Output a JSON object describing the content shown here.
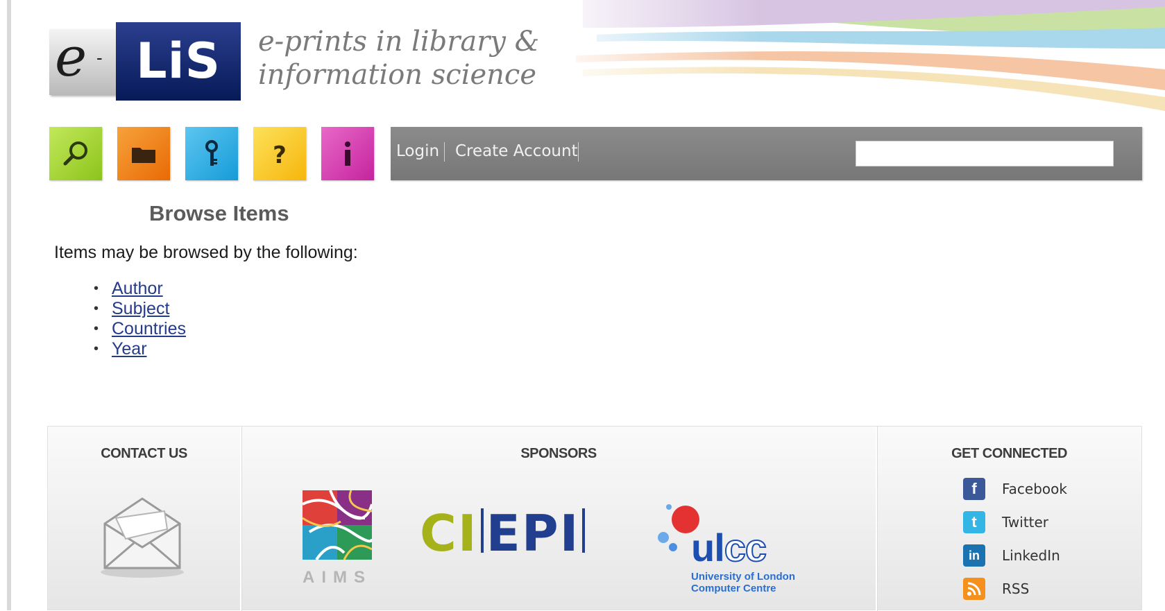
{
  "brand": {
    "logo_e": "e",
    "logo_dash": "-",
    "logo_lis": "LiS",
    "tagline_line1": "e-prints in library &",
    "tagline_line2": "information science"
  },
  "nav": {
    "tiles": [
      {
        "name": "search",
        "icon": "magnifier-icon",
        "color": "#8cc41b"
      },
      {
        "name": "browse",
        "icon": "folder-icon",
        "color": "#e96a05"
      },
      {
        "name": "login",
        "icon": "key-icon",
        "color": "#169bd8"
      },
      {
        "name": "help",
        "icon": "question-icon",
        "color": "#f6b60c"
      },
      {
        "name": "info",
        "icon": "info-icon",
        "color": "#c5249d"
      }
    ],
    "login_label": "Login",
    "create_account_label": "Create Account",
    "search_value": ""
  },
  "main": {
    "title": "Browse Items",
    "intro": "Items may be browsed by the following:",
    "browse_options": [
      "Author",
      "Subject",
      "Countries",
      "Year"
    ]
  },
  "footer": {
    "contact_heading": "CONTACT US",
    "sponsors_heading": "SPONSORS",
    "connect_heading": "GET CONNECTED",
    "sponsors": {
      "aims_label": "AIMS",
      "ciepi_ci": "CI",
      "ciepi_epi": "EPI",
      "ulcc_u": "u",
      "ulcc_l": "l",
      "ulcc_cc": "cc",
      "ulcc_line1": "University of London",
      "ulcc_line2": "Computer Centre"
    },
    "social": [
      {
        "label": "Facebook",
        "icon": "facebook-icon",
        "color": "#3b5998"
      },
      {
        "label": "Twitter",
        "icon": "twitter-icon",
        "color": "#33b5e5"
      },
      {
        "label": "LinkedIn",
        "icon": "linkedin-icon",
        "color": "#1a73b0"
      },
      {
        "label": "RSS",
        "icon": "rss-icon",
        "color": "#f5901c"
      }
    ]
  }
}
